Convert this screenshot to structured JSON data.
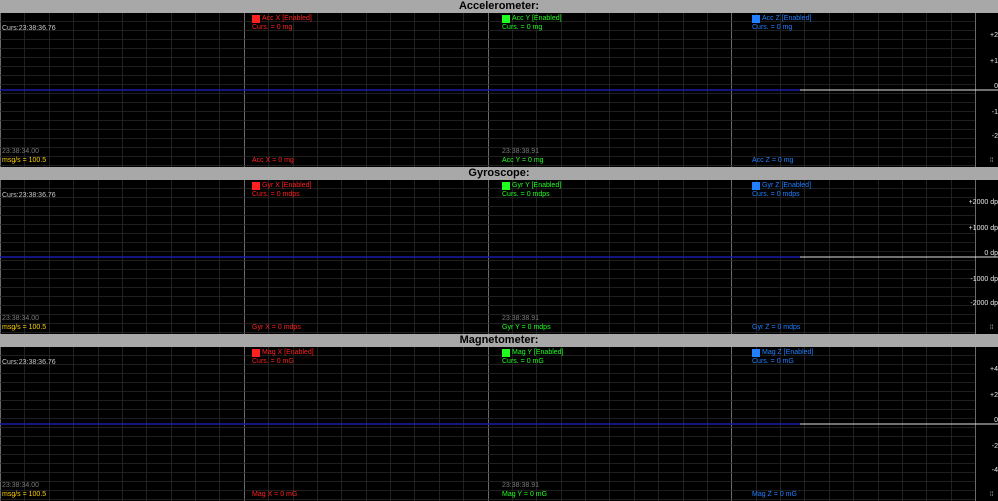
{
  "colors": {
    "x": "#ff2020",
    "y": "#20ff20",
    "z": "#2080ff",
    "trace": "#1a1aa8",
    "cursor_info": "#c8c8c8",
    "rate": "#ffd400",
    "time": "#7a7a7a"
  },
  "panels": [
    {
      "title": "Accelerometer:",
      "cursor_time": "Curs:23:38:36.76",
      "time_start": "23:38:34.00",
      "time_mid": "23:38:38.91",
      "rate": "msg/s = 100.5",
      "legend": [
        {
          "label": "Acc X [Enabled]",
          "curs": "Curs. = 0 mg",
          "value": "Acc X = 0 mg"
        },
        {
          "label": "Acc Y [Enabled]",
          "curs": "Curs. = 0 mg",
          "value": "Acc Y = 0 mg"
        },
        {
          "label": "Acc Z [Enabled]",
          "curs": "Curs. = 0 mg",
          "value": "Acc Z = 0 mg"
        }
      ],
      "y_ticks": [
        "+2",
        "+1",
        "0",
        "-1",
        "-2"
      ]
    },
    {
      "title": "Gyroscope:",
      "cursor_time": "Curs:23:38:36.76",
      "time_start": "23:38:34.00",
      "time_mid": "23:38:38.91",
      "rate": "msg/s = 100.5",
      "legend": [
        {
          "label": "Gyr X [Enabled]",
          "curs": "Curs. = 0 mdps",
          "value": "Gyr X = 0 mdps"
        },
        {
          "label": "Gyr Y [Enabled]",
          "curs": "Curs. = 0 mdps",
          "value": "Gyr Y = 0 mdps"
        },
        {
          "label": "Gyr Z [Enabled]",
          "curs": "Curs. = 0 mdps",
          "value": "Gyr Z = 0 mdps"
        }
      ],
      "y_ticks": [
        "+2000 dp",
        "+1000 dp",
        "0 dp",
        "-1000 dp",
        "-2000 dp"
      ]
    },
    {
      "title": "Magnetometer:",
      "cursor_time": "Curs:23:38:36.76",
      "time_start": "23:38:34.00",
      "time_mid": "23:38:38.91",
      "rate": "msg/s = 100.5",
      "legend": [
        {
          "label": "Mag X [Enabled]",
          "curs": "Curs. = 0 mG",
          "value": "Mag X = 0 mG"
        },
        {
          "label": "Mag Y [Enabled]",
          "curs": "Curs. = 0 mG",
          "value": "Mag Y = 0 mG"
        },
        {
          "label": "Mag Z [Enabled]",
          "curs": "Curs. = 0 mG",
          "value": "Mag Z = 0 mG"
        }
      ],
      "y_ticks": [
        "+4",
        "+2",
        "0",
        "-2",
        "-4"
      ]
    }
  ]
}
